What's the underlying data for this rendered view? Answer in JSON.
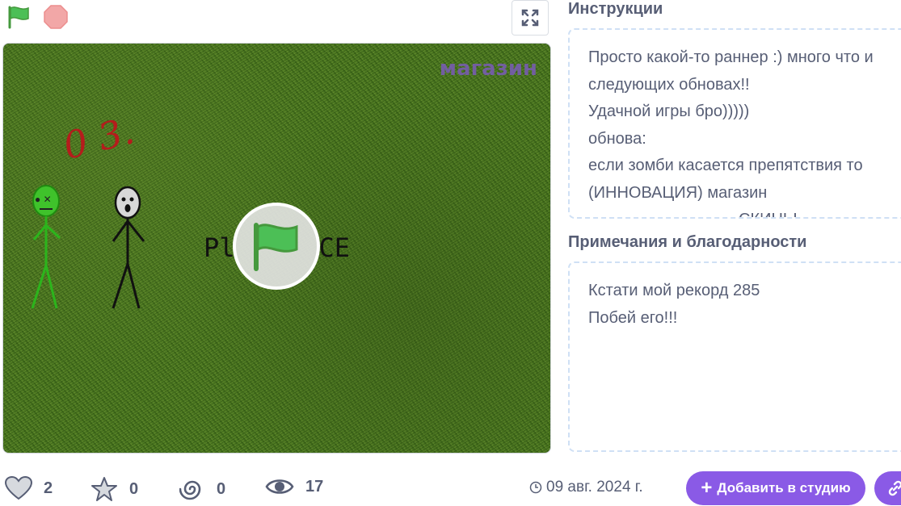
{
  "controls": {
    "green_flag_icon": "green-flag",
    "stop_icon": "stop-sign",
    "fullscreen_icon": "fullscreen"
  },
  "stage": {
    "shop_text": "магазин",
    "score_text": "0 3.",
    "play_text_left": "Pl",
    "play_text_right": "CE"
  },
  "instructions": {
    "title": "Инструкции",
    "lines": [
      "Просто какой-то раннер :) много что и",
      "следующих обновах!!",
      "Удачной игры бро)))))",
      "обнова:",
      "если зомби касается препятствия то",
      "(ИННОВАЦИЯ) магазин",
      "СКИНЫ"
    ]
  },
  "notes": {
    "title": "Примечания и благодарности",
    "lines": [
      "Кстати мой рекорд 285",
      "Побей его!!!"
    ]
  },
  "stats": {
    "loves": "2",
    "favorites": "0",
    "remixes": "0",
    "views": "17",
    "date": "09 авг. 2024 г."
  },
  "buttons": {
    "add_to_studio": "Добавить в студию"
  },
  "colors": {
    "accent": "#8a5ae6",
    "flag_green": "#4cbf56",
    "stop_red": "#ec5959"
  }
}
